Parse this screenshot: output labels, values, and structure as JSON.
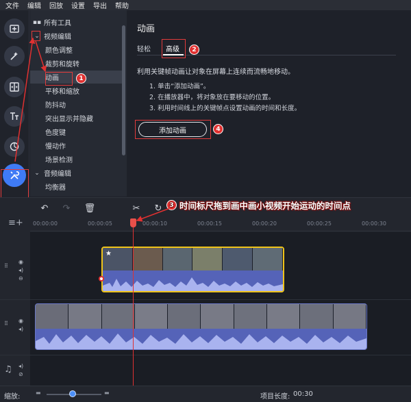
{
  "menu": [
    "文件",
    "编辑",
    "回放",
    "设置",
    "导出",
    "帮助"
  ],
  "rail_icons": [
    "import-icon",
    "magic-icon",
    "transition-icon",
    "titles-icon",
    "sticker-icon",
    "tools-icon"
  ],
  "tree": {
    "items": [
      {
        "label": "所有工具",
        "icon": "grid-icon"
      },
      {
        "label": "视频编辑",
        "icon": "chevron-down-icon"
      },
      {
        "label": "颜色调整"
      },
      {
        "label": "裁剪和旋转"
      },
      {
        "label": "动画"
      },
      {
        "label": "平移和缩放"
      },
      {
        "label": "防抖动"
      },
      {
        "label": "突出显示并隐藏"
      },
      {
        "label": "色度键"
      },
      {
        "label": "慢动作"
      },
      {
        "label": "场景检测"
      },
      {
        "label": "音频编辑",
        "icon": "chevron-down-icon"
      },
      {
        "label": "均衡器"
      }
    ]
  },
  "panel": {
    "title": "动画",
    "tabs": [
      "轻松",
      "高级"
    ],
    "description": "利用关键帧动画让对象在屏幕上连续而流畅地移动。",
    "steps": [
      "1. 单击“添加动画”。",
      "2. 在播放器中，将对象放在要移动的位置。",
      "3. 利用时间线上的关键帧点设置动画的时间和长度。"
    ],
    "add_button": "添加动画"
  },
  "badges": [
    "1",
    "2",
    "3",
    "4"
  ],
  "annotation3": "时间标尺拖到画中画小视频开始运动的时间点",
  "ruler": [
    "00:00:00",
    "00:00:05",
    "00:00:10",
    "00:00:15",
    "00:00:20",
    "00:00:25",
    "00:00:30"
  ],
  "status": {
    "zoom_label": "缩放:",
    "zoom_level": 0.6,
    "length_label": "项目长度:",
    "length_value": "00:30"
  },
  "colors": {
    "accent": "#3f7bf5",
    "annotation": "#e03131",
    "pip_border": "#f0c419"
  }
}
